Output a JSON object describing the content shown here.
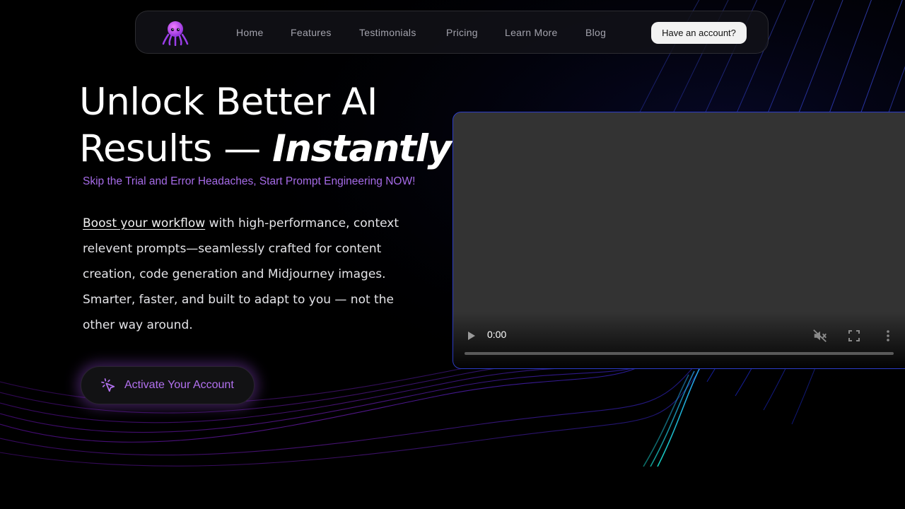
{
  "nav": {
    "logo": "octopus-logo",
    "items": [
      {
        "label": "Home"
      },
      {
        "label": "Features"
      },
      {
        "label": "Testimonials"
      },
      {
        "label": "Pricing"
      },
      {
        "label": "Learn More"
      },
      {
        "label": "Blog"
      }
    ],
    "account_button": "Have an account?"
  },
  "hero": {
    "title_line1": "Unlock Better AI",
    "title_line2": "Results — ",
    "title_emphasis": "Instantly",
    "subhead": "Skip the Trial and Error Headaches, Start Prompt Engineering NOW!",
    "desc_link": "Boost your workflow",
    "desc_text": " with high-performance, context relevent prompts—seamlessly crafted for content creation, code generation and Midjourney images. Smarter, faster, and built to adapt to you — not the other way around.",
    "cta_label": "Activate Your Account",
    "cta_icon": "cursor-click-icon"
  },
  "video": {
    "time": "0:00",
    "progress": 0,
    "controls": [
      "play-icon",
      "mute-icon",
      "fullscreen-icon",
      "more-icon"
    ]
  },
  "colors": {
    "background": "#000000",
    "accent_purple": "#a66be8",
    "wave_blue": "#1a2cff",
    "wave_purple": "#8a20d8",
    "wave_cyan": "#18d8d0",
    "video_border": "#2c3cc8"
  }
}
